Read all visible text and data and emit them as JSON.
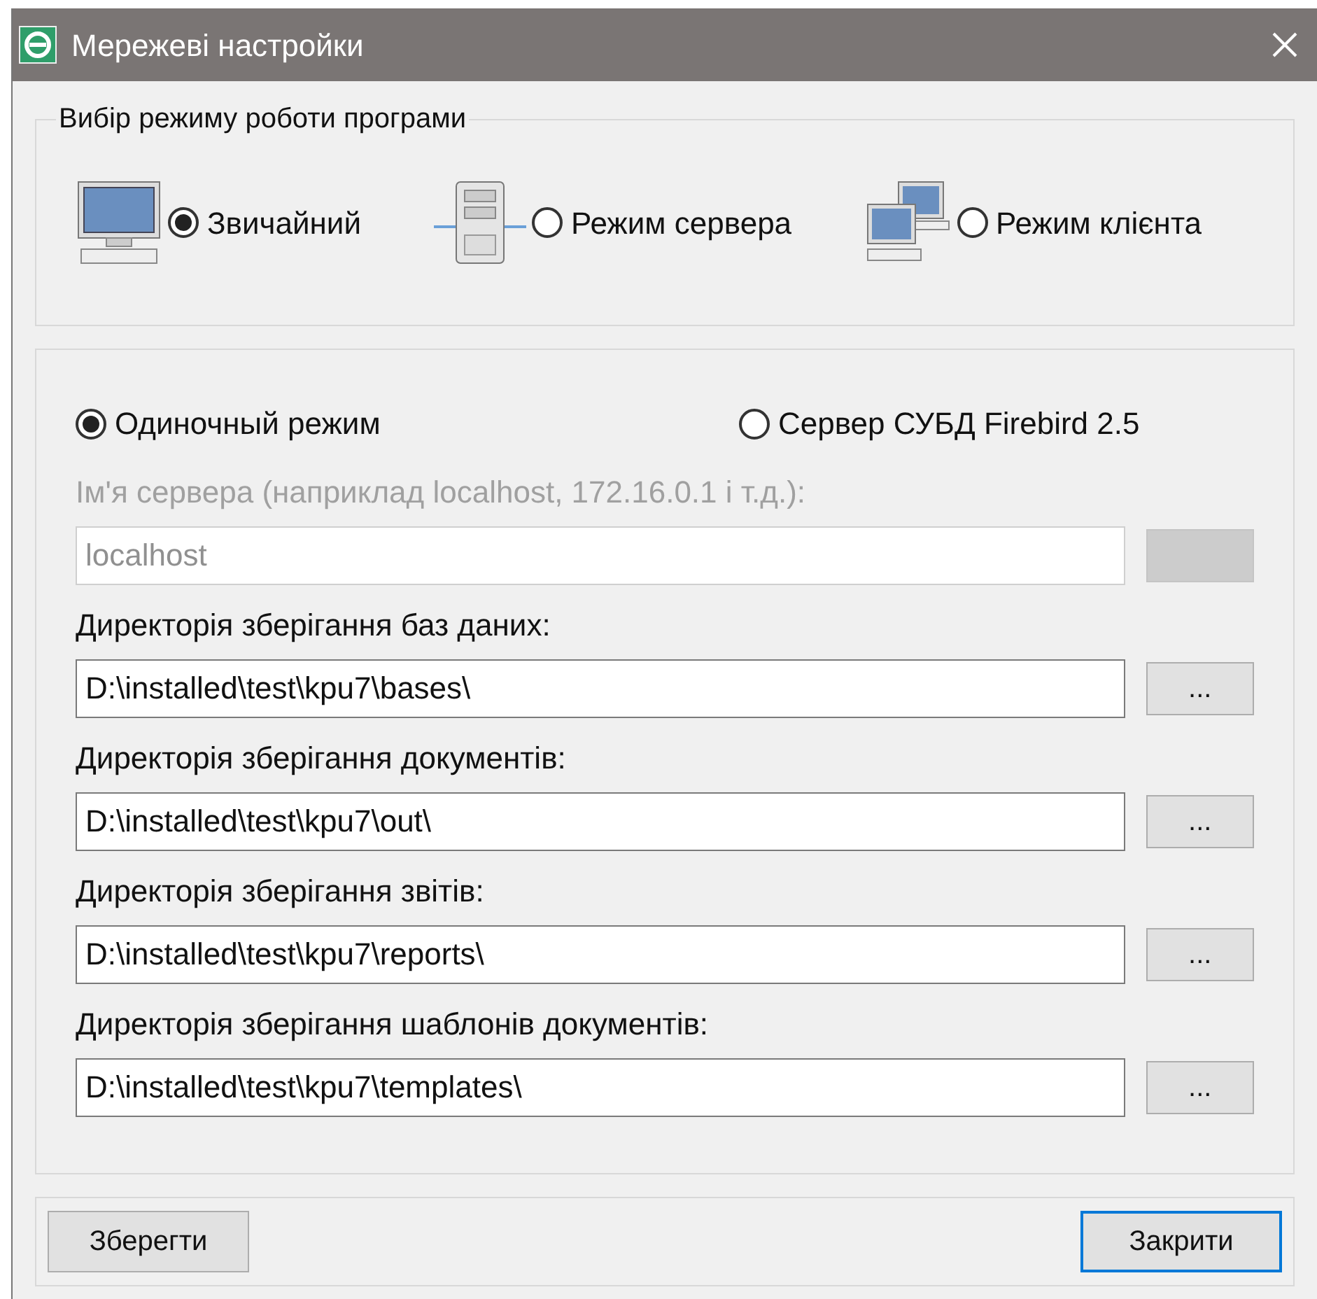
{
  "window": {
    "title": "Мережеві настройки"
  },
  "mode_group": {
    "title": "Вибір режиму роботи програми",
    "options": [
      {
        "kind": "desktop",
        "label": "Звичайний",
        "selected": true
      },
      {
        "kind": "server",
        "label": "Режим сервера",
        "selected": false
      },
      {
        "kind": "network",
        "label": "Режим клієнта",
        "selected": false
      }
    ]
  },
  "db_modes": [
    {
      "label": "Одиночный режим",
      "selected": true
    },
    {
      "label": "Сервер СУБД Firebird 2.5",
      "selected": false
    }
  ],
  "server_name": {
    "label": "Ім'я сервера (наприклад localhost, 172.16.0.1 і т.д.):",
    "value": "localhost",
    "disabled": true
  },
  "directories": [
    {
      "label": "Директорія зберігання баз даних:",
      "value": "D:\\installed\\test\\kpu7\\bases\\",
      "button": "..."
    },
    {
      "label": "Директорія зберігання документів:",
      "value": "D:\\installed\\test\\kpu7\\out\\",
      "button": "..."
    },
    {
      "label": "Директорія зберігання звітів:",
      "value": "D:\\installed\\test\\kpu7\\reports\\",
      "button": "..."
    },
    {
      "label": "Директорія зберігання шаблонів документів:",
      "value": "D:\\installed\\test\\kpu7\\templates\\",
      "button": "..."
    }
  ],
  "buttons": [
    {
      "label": "Зберегти",
      "default": false
    },
    {
      "label": "Закрити",
      "default": true
    }
  ]
}
